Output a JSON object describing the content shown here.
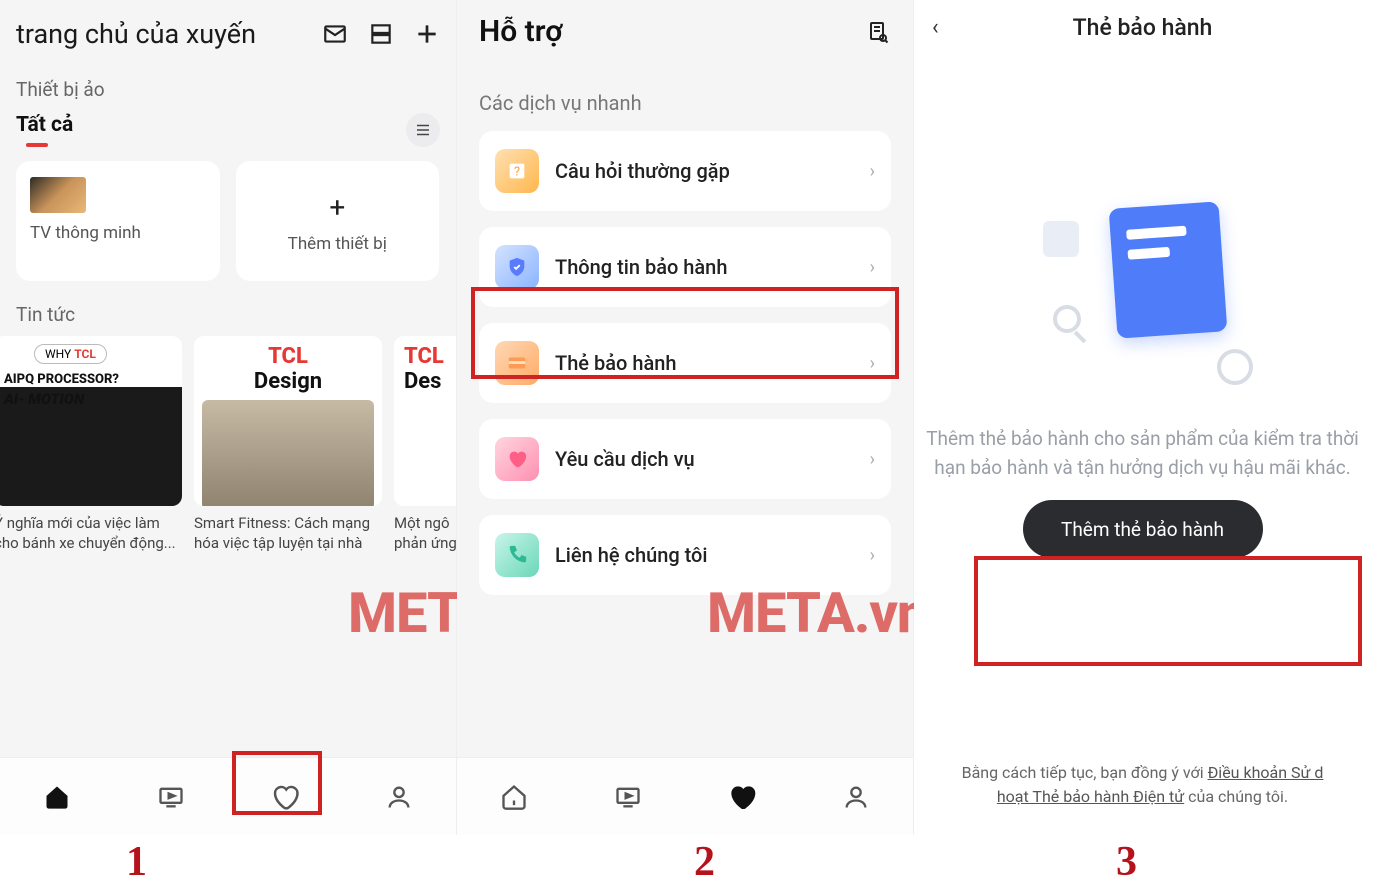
{
  "screen1": {
    "header": {
      "title": "trang chủ của xuyến"
    },
    "section_devices": "Thiết bị ảo",
    "tab_all": "Tất cả",
    "device_tv": "TV thông minh",
    "device_add": "Thêm thiết bị",
    "section_news": "Tin tức",
    "news": [
      {
        "badge_why": "WHY",
        "badge_tcl": "TCL",
        "line1": "AIPQ PROCESSOR?",
        "line2": "Ai-  MOTION",
        "caption": "Ý nghĩa mới của việc làm cho bánh xe chuyển động..."
      },
      {
        "brand": "TCL",
        "design": "Design",
        "caption": "Smart Fitness: Cách mạng hóa việc tập luyện tại nhà"
      },
      {
        "brand": "TCL",
        "design": "Des",
        "caption": "Một ngô\nphản ứng"
      }
    ]
  },
  "screen2": {
    "title": "Hỗ trợ",
    "section": "Các dịch vụ nhanh",
    "services": [
      {
        "label": "Câu hỏi thường gặp"
      },
      {
        "label": "Thông tin bảo hành"
      },
      {
        "label": "Thẻ bảo hành"
      },
      {
        "label": "Yêu cầu dịch vụ"
      },
      {
        "label": "Liên hệ chúng tôi"
      }
    ]
  },
  "screen3": {
    "title": "Thẻ bảo hành",
    "desc": "Thêm thẻ bảo hành cho sản phẩm của kiểm tra thời hạn bảo hành và tận hưởng dịch vụ hậu mãi khác.",
    "button": "Thêm thẻ bảo hành",
    "footer_pre": "Bằng cách tiếp tục, bạn đồng ý với ",
    "footer_link1": "Điều khoản Sử d",
    "footer_mid": "hoạt Thẻ bảo hành Điện tử",
    "footer_end": " của chúng tôi."
  },
  "steps": {
    "s1": "1",
    "s2": "2",
    "s3": "3"
  },
  "watermark": "META.vn"
}
